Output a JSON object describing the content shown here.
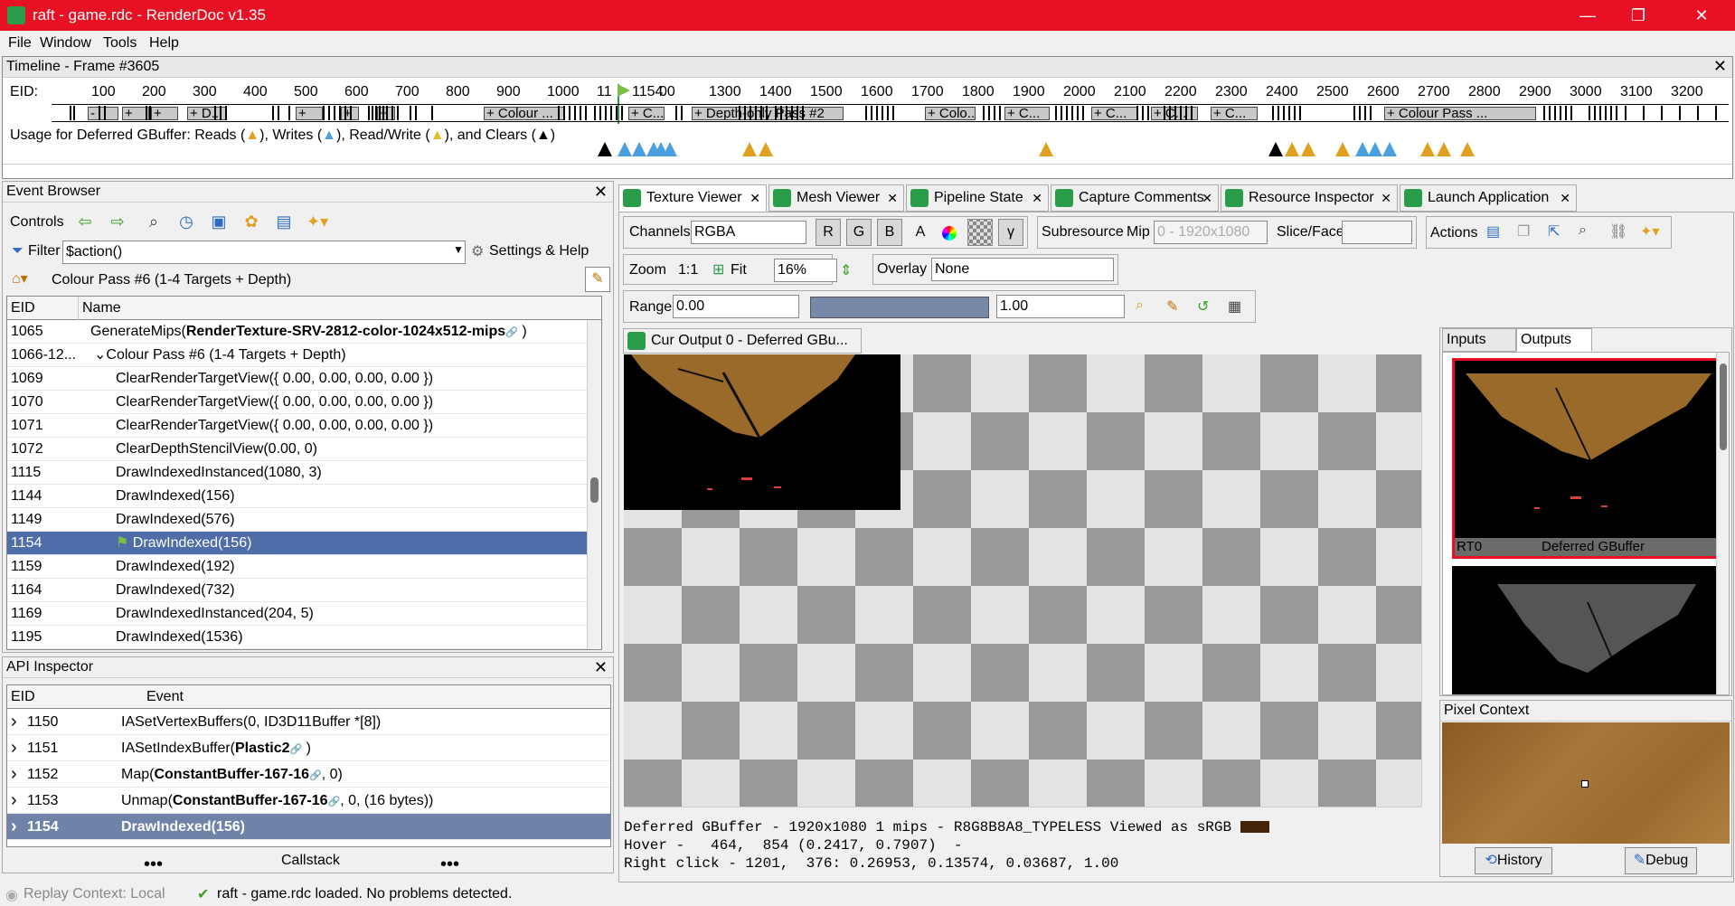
{
  "window": {
    "title": "raft - game.rdc - RenderDoc v1.35",
    "minimize": "—",
    "restore": "❐",
    "close": "✕"
  },
  "menu": {
    "items": [
      "File",
      "Window",
      "Tools",
      "Help"
    ]
  },
  "timeline": {
    "title": "Timeline - Frame #3605",
    "eid_label": "EID:",
    "ticks": [
      "100",
      "200",
      "300",
      "400",
      "500",
      "600",
      "700",
      "800",
      "900",
      "1000",
      "11",
      "1154",
      "00",
      "1300",
      "1400",
      "1500",
      "1600",
      "1700",
      "1800",
      "1900",
      "2000",
      "2100",
      "2200",
      "2300",
      "2400",
      "2500",
      "2600",
      "2700",
      "2800",
      "2900",
      "3000",
      "3100",
      "3200"
    ],
    "segments": [
      "-",
      "+",
      "+",
      "+ D...",
      "+",
      "+",
      "+",
      "+ Colour ...",
      "+ C...",
      "+ Depth-only Pass #2",
      "+ Colo...",
      "+ C...",
      "+ C...",
      "+ C...",
      "+ C...",
      "+ Colour Pass ..."
    ],
    "usage_label": "Usage for Deferred GBuffer: Reads (",
    "usage_writes": "), Writes (",
    "usage_rw": "), Read/Write (",
    "usage_clears": "), and Clears (",
    "usage_end": ")"
  },
  "event_browser": {
    "title": "Event Browser",
    "controls_label": "Controls",
    "filter_label": "Filter",
    "filter_value": "$action()",
    "settings_label": "Settings & Help",
    "breadcrumb": "Colour Pass #6 (1-4 Targets + Depth)",
    "col_eid": "EID",
    "col_name": "Name",
    "rows": [
      {
        "eid": "1065",
        "name": "GenerateMips(",
        "bold": "RenderTexture-SRV-2812-color-1024x512-mips",
        "tail": " )"
      },
      {
        "eid": "1066-12...",
        "name": "⌄Colour Pass #6 (1-4 Targets + Depth)",
        "bold": "",
        "tail": ""
      },
      {
        "eid": "1069",
        "name": "ClearRenderTargetView({ 0.00, 0.00, 0.00, 0.00 })",
        "bold": "",
        "tail": ""
      },
      {
        "eid": "1070",
        "name": "ClearRenderTargetView({ 0.00, 0.00, 0.00, 0.00 })",
        "bold": "",
        "tail": ""
      },
      {
        "eid": "1071",
        "name": "ClearRenderTargetView({ 0.00, 0.00, 0.00, 0.00 })",
        "bold": "",
        "tail": ""
      },
      {
        "eid": "1072",
        "name": "ClearDepthStencilView(0.00, 0)",
        "bold": "",
        "tail": ""
      },
      {
        "eid": "1115",
        "name": "DrawIndexedInstanced(1080, 3)",
        "bold": "",
        "tail": ""
      },
      {
        "eid": "1144",
        "name": "DrawIndexed(156)",
        "bold": "",
        "tail": ""
      },
      {
        "eid": "1149",
        "name": "DrawIndexed(576)",
        "bold": "",
        "tail": ""
      },
      {
        "eid": "1154",
        "name": "DrawIndexed(156)",
        "bold": "",
        "tail": ""
      },
      {
        "eid": "1159",
        "name": "DrawIndexed(192)",
        "bold": "",
        "tail": ""
      },
      {
        "eid": "1164",
        "name": "DrawIndexed(732)",
        "bold": "",
        "tail": ""
      },
      {
        "eid": "1169",
        "name": "DrawIndexedInstanced(204, 5)",
        "bold": "",
        "tail": ""
      },
      {
        "eid": "1195",
        "name": "DrawIndexed(1536)",
        "bold": "",
        "tail": ""
      }
    ]
  },
  "api_inspector": {
    "title": "API Inspector",
    "col_eid": "EID",
    "col_event": "Event",
    "rows": [
      {
        "eid": "1150",
        "pre": "IASetVertexBuffers(0, ID3D11Buffer *[8])",
        "bold": "",
        "post": ""
      },
      {
        "eid": "1151",
        "pre": "IASetIndexBuffer(",
        "bold": "Plastic2",
        "post": " )"
      },
      {
        "eid": "1152",
        "pre": "Map(",
        "bold": "ConstantBuffer-167-16",
        "post": ", 0)"
      },
      {
        "eid": "1153",
        "pre": "Unmap(",
        "bold": "ConstantBuffer-167-16",
        "post": ", 0, (16 bytes))"
      },
      {
        "eid": "1154",
        "pre": "DrawIndexed(156)",
        "bold": "",
        "post": ""
      }
    ],
    "dots": "•••",
    "callstack": "Callstack"
  },
  "tabs": [
    "Texture Viewer",
    "Mesh Viewer",
    "Pipeline State",
    "Capture Comments",
    "Resource Inspector",
    "Launch Application"
  ],
  "texture_viewer": {
    "channels_label": "Channels",
    "channels_value": "RGBA",
    "chan_buttons": [
      "R",
      "G",
      "B",
      "A"
    ],
    "gamma": "γ",
    "subresource_label": "Subresource",
    "mip_label": "Mip",
    "mip_value": "0 - 1920x1080",
    "slice_label": "Slice/Face",
    "actions_label": "Actions",
    "zoom_label": "Zoom",
    "zoom_1to1": "1:1",
    "fit_label": "Fit",
    "zoom_value": "16%",
    "overlay_label": "Overlay",
    "overlay_value": "None",
    "range_label": "Range",
    "range_min": "0.00",
    "range_max": "1.00",
    "output_tab": "Cur Output 0 - Deferred GBu...",
    "status_line1": "Deferred GBuffer - 1920x1080 1 mips - R8G8B8A8_TYPELESS Viewed as sRGB",
    "status_line2": "Hover -   464,  854 (0.2417, 0.7907)  -",
    "status_line3": "Right click - 1201,  376: 0.26953, 0.13574, 0.03687, 1.00",
    "swatch_color": "#452309"
  },
  "side_panel": {
    "tab_inputs": "Inputs",
    "tab_outputs": "Outputs",
    "rt_label": "RT0",
    "rt_name": "Deferred GBuffer",
    "pixel_context_title": "Pixel Context",
    "history_button": "History",
    "debug_button": "Debug"
  },
  "status": {
    "replay": "Replay Context: Local",
    "message": "raft - game.rdc loaded. No problems detected."
  },
  "colors": {
    "titlebar": "#e81123",
    "selection": "#4f6da8",
    "accent_green": "#2a9d4a"
  }
}
